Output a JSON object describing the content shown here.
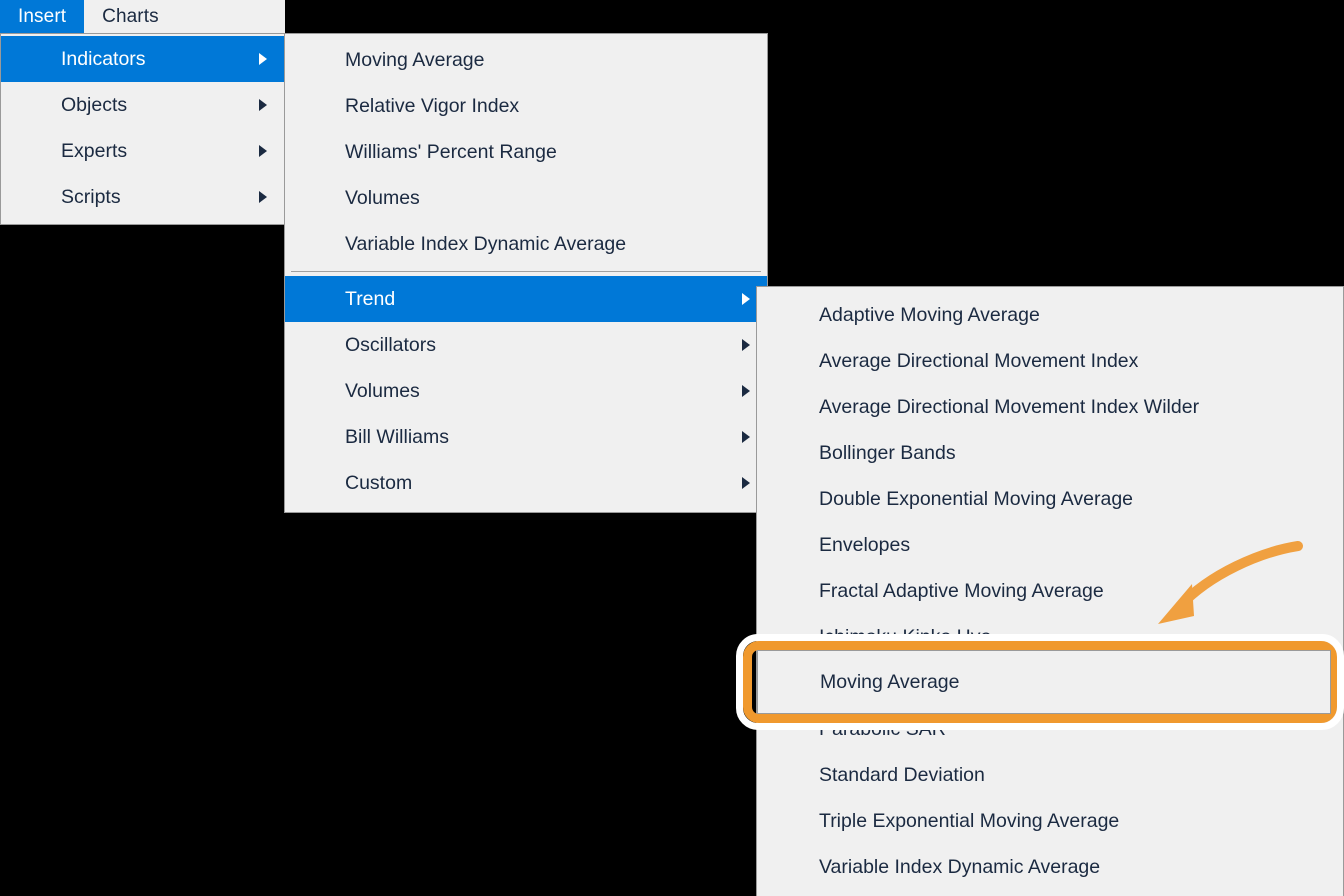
{
  "menubar": {
    "items": [
      {
        "label": "Insert",
        "active": true
      },
      {
        "label": "Charts",
        "active": false
      }
    ]
  },
  "panel_insert": {
    "name": "Insert menu",
    "items": [
      {
        "label": "Indicators",
        "has_submenu": true,
        "highlighted": true
      },
      {
        "label": "Objects",
        "has_submenu": true,
        "highlighted": false
      },
      {
        "label": "Experts",
        "has_submenu": true,
        "highlighted": false
      },
      {
        "label": "Scripts",
        "has_submenu": true,
        "highlighted": false
      }
    ]
  },
  "panel_indicators": {
    "name": "Indicators submenu",
    "recent_items": [
      {
        "label": "Moving Average",
        "has_submenu": false,
        "highlighted": false
      },
      {
        "label": "Relative Vigor Index",
        "has_submenu": false,
        "highlighted": false
      },
      {
        "label": "Williams' Percent Range",
        "has_submenu": false,
        "highlighted": false
      },
      {
        "label": "Volumes",
        "has_submenu": false,
        "highlighted": false
      },
      {
        "label": "Variable Index Dynamic Average",
        "has_submenu": false,
        "highlighted": false
      }
    ],
    "category_items": [
      {
        "label": "Trend",
        "has_submenu": true,
        "highlighted": true
      },
      {
        "label": "Oscillators",
        "has_submenu": true,
        "highlighted": false
      },
      {
        "label": "Volumes",
        "has_submenu": true,
        "highlighted": false
      },
      {
        "label": "Bill Williams",
        "has_submenu": true,
        "highlighted": false
      },
      {
        "label": "Custom",
        "has_submenu": true,
        "highlighted": false
      }
    ]
  },
  "panel_trend": {
    "name": "Trend submenu",
    "items_top": [
      {
        "label": "Adaptive Moving Average"
      },
      {
        "label": "Average Directional Movement Index"
      },
      {
        "label": "Average Directional Movement Index Wilder"
      },
      {
        "label": "Bollinger Bands"
      },
      {
        "label": "Double Exponential Moving Average"
      },
      {
        "label": "Envelopes"
      },
      {
        "label": "Fractal Adaptive Moving Average"
      },
      {
        "label": "Ichimoku Kinko Hyo"
      }
    ],
    "items_bottom": [
      {
        "label": "Parabolic SAR"
      },
      {
        "label": "Standard Deviation"
      },
      {
        "label": "Triple Exponential Moving Average"
      },
      {
        "label": "Variable Index Dynamic Average"
      }
    ]
  },
  "callout": {
    "name": "highlighted menu item",
    "label": "Moving Average",
    "highlight_color": "#f0992e",
    "ring_color": "#ffffff"
  },
  "annotation": {
    "arrow_name": "curved-arrow-icon",
    "arrow_color": "#f0a040"
  },
  "colors": {
    "menu_background": "#f0f0f0",
    "menu_border": "#9a9a9a",
    "menu_text": "#1b2a41",
    "accent_blue": "#0078d7",
    "accent_orange": "#f0992e",
    "page_background": "#000000"
  }
}
